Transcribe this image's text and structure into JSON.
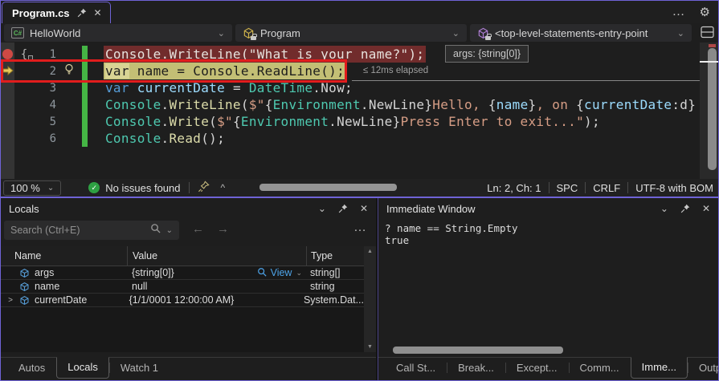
{
  "colors": {
    "accent": "#6f63d6",
    "keyword": "#569CD6",
    "class": "#4EC9B0",
    "method": "#DCDCAA",
    "string": "#D69D85",
    "variable": "#9CDCFE",
    "plain": "#D4D4D4",
    "bp_line_bg": "#712c2c",
    "bp_line_text": "#e7e2dd",
    "cur_line_bg": "#c3bf75",
    "cur_line_text": "#1c1c1c",
    "var_box_bg": "#d9d494",
    "green_bar": "#45b545",
    "breakpoint_red": "#cd4944",
    "annotation_red": "#e11d1d"
  },
  "icons": {
    "chevron_down": "⌄",
    "close": "✕",
    "more": "…",
    "gear": "⚙",
    "back": "←",
    "forward": "→",
    "caret_up": "^",
    "check": "✓",
    "scroll_up": "▲",
    "scroll_down": "▼",
    "expander": ">"
  },
  "titlebar": {
    "tab_label": "Program.cs"
  },
  "breadcrumb": {
    "project": "HelloWorld",
    "type_name": "Program",
    "member": "<top-level-statements-entry-point"
  },
  "editor": {
    "datatip": "args: {string[0]}",
    "perftip": "≤ 12ms elapsed",
    "lines": [
      {
        "num": "1",
        "gutter": "breakpoint",
        "braces": true,
        "bulb": false,
        "bg": "bp",
        "tokens": [
          {
            "t": "Console.WriteLine(\"What is your name?\");",
            "c": "bp"
          }
        ]
      },
      {
        "num": "2",
        "gutter": "arrow",
        "braces": false,
        "bulb": true,
        "bg": "cur",
        "tokens": [
          {
            "t": "var",
            "c": "curvar"
          },
          {
            "t": " name = Console.ReadLine();",
            "c": "cur"
          }
        ]
      },
      {
        "num": "3",
        "gutter": "",
        "braces": false,
        "bulb": false,
        "bg": "",
        "tokens": [
          {
            "t": "var",
            "c": "keyword"
          },
          {
            "t": " ",
            "c": "plain"
          },
          {
            "t": "currentDate",
            "c": "variable"
          },
          {
            "t": " = ",
            "c": "plain"
          },
          {
            "t": "DateTime",
            "c": "class"
          },
          {
            "t": ".Now;",
            "c": "plain"
          }
        ]
      },
      {
        "num": "4",
        "gutter": "",
        "braces": false,
        "bulb": false,
        "bg": "",
        "tokens": [
          {
            "t": "Console",
            "c": "class"
          },
          {
            "t": ".",
            "c": "plain"
          },
          {
            "t": "WriteLine",
            "c": "method"
          },
          {
            "t": "(",
            "c": "plain"
          },
          {
            "t": "$\"",
            "c": "string"
          },
          {
            "t": "{",
            "c": "plain"
          },
          {
            "t": "Environment",
            "c": "class"
          },
          {
            "t": ".NewLine",
            "c": "plain"
          },
          {
            "t": "}",
            "c": "plain"
          },
          {
            "t": "Hello, ",
            "c": "string"
          },
          {
            "t": "{",
            "c": "plain"
          },
          {
            "t": "name",
            "c": "variable"
          },
          {
            "t": "}",
            "c": "plain"
          },
          {
            "t": ", on ",
            "c": "string"
          },
          {
            "t": "{",
            "c": "plain"
          },
          {
            "t": "currentDate",
            "c": "variable"
          },
          {
            "t": ":d",
            "c": "plain"
          },
          {
            "t": "}",
            "c": "plain"
          }
        ]
      },
      {
        "num": "5",
        "gutter": "",
        "braces": false,
        "bulb": false,
        "bg": "",
        "tokens": [
          {
            "t": "Console",
            "c": "class"
          },
          {
            "t": ".",
            "c": "plain"
          },
          {
            "t": "Write",
            "c": "method"
          },
          {
            "t": "(",
            "c": "plain"
          },
          {
            "t": "$\"",
            "c": "string"
          },
          {
            "t": "{",
            "c": "plain"
          },
          {
            "t": "Environment",
            "c": "class"
          },
          {
            "t": ".NewLine",
            "c": "plain"
          },
          {
            "t": "}",
            "c": "plain"
          },
          {
            "t": "Press Enter to exit...",
            "c": "string"
          },
          {
            "t": "\"",
            "c": "string"
          },
          {
            "t": ");",
            "c": "plain"
          }
        ]
      },
      {
        "num": "6",
        "gutter": "",
        "braces": false,
        "bulb": false,
        "bg": "",
        "tokens": [
          {
            "t": "Console",
            "c": "class"
          },
          {
            "t": ".",
            "c": "plain"
          },
          {
            "t": "Read",
            "c": "method"
          },
          {
            "t": "();",
            "c": "plain"
          }
        ]
      }
    ]
  },
  "status_bar": {
    "zoom_level": "100 %",
    "issues": "No issues found",
    "line_col": "Ln: 2, Ch: 1",
    "whitespace": "SPC",
    "line_ending": "CRLF",
    "encoding": "UTF-8 with BOM"
  },
  "locals": {
    "title": "Locals",
    "search_placeholder": "Search (Ctrl+E)",
    "columns": [
      "Name",
      "Value",
      "Type"
    ],
    "view_label": "View",
    "rows": [
      {
        "name": "args",
        "value": "{string[0]}",
        "type": "string[]",
        "view": "View",
        "expandable": false
      },
      {
        "name": "name",
        "value": "null",
        "type": "string",
        "view": null,
        "expandable": false
      },
      {
        "name": "currentDate",
        "value": "{1/1/0001 12:00:00 AM}",
        "type": "System.Dat...",
        "view": null,
        "expandable": true
      }
    ],
    "tabs": [
      {
        "label": "Autos",
        "active": false
      },
      {
        "label": "Locals",
        "active": true
      },
      {
        "label": "Watch 1",
        "active": false
      }
    ]
  },
  "immediate": {
    "title": "Immediate Window",
    "lines": [
      "? name == String.Empty",
      "true"
    ],
    "tabs": [
      {
        "label": "Call St...",
        "active": false
      },
      {
        "label": "Break...",
        "active": false
      },
      {
        "label": "Except...",
        "active": false
      },
      {
        "label": "Comm...",
        "active": false
      },
      {
        "label": "Imme...",
        "active": true
      },
      {
        "label": "Output",
        "active": false
      }
    ]
  }
}
